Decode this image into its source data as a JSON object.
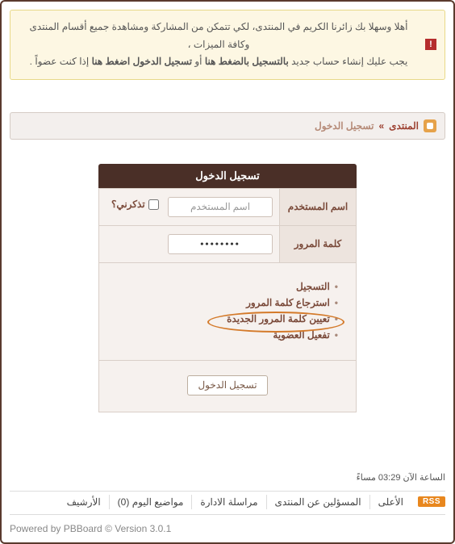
{
  "alert": {
    "line1": "أهلا وسهلا بك زائرنا الكريم في المنتدى، لكي تتمكن من المشاركة ومشاهدة جميع أقسام المنتدى وكافة الميزات ،",
    "line2_p1": "يجب عليك إنشاء حساب جديد ",
    "register_bold": "بالتسجيل بالضغط هنا",
    "or": " أو ",
    "login_bold": "تسجيل الدخول اضغط هنا",
    "line2_p2": " إذا كنت عضواً ."
  },
  "breadcrumb": {
    "forum": "المنتدى",
    "sep": "»",
    "current": "تسجيل الدخول"
  },
  "login": {
    "header": "تسجيل الدخول",
    "username_label": "اسم المستخدم",
    "username_placeholder": "اسم المستخدم",
    "remember": "تذكرني؟",
    "password_label": "كلمة المرور",
    "password_value": "password",
    "submit": "تسجيل الدخول"
  },
  "links": [
    "التسجيل",
    "استرجاع كلمة المرور",
    "تعيين كلمة المرور الجديدة",
    "تفعيل العضوية"
  ],
  "footer": {
    "time": "الساعة الآن 03:29 مساءً",
    "rss": "RSS",
    "nav": [
      "الأعلى",
      "المسؤلين عن المنتدى",
      "مراسلة الادارة",
      "مواضيع اليوم (0)",
      "الأرشيف"
    ],
    "powered_prefix": "Powered by ",
    "powered_name": "PBBoard",
    "powered_version": " © Version 3.0.1"
  }
}
